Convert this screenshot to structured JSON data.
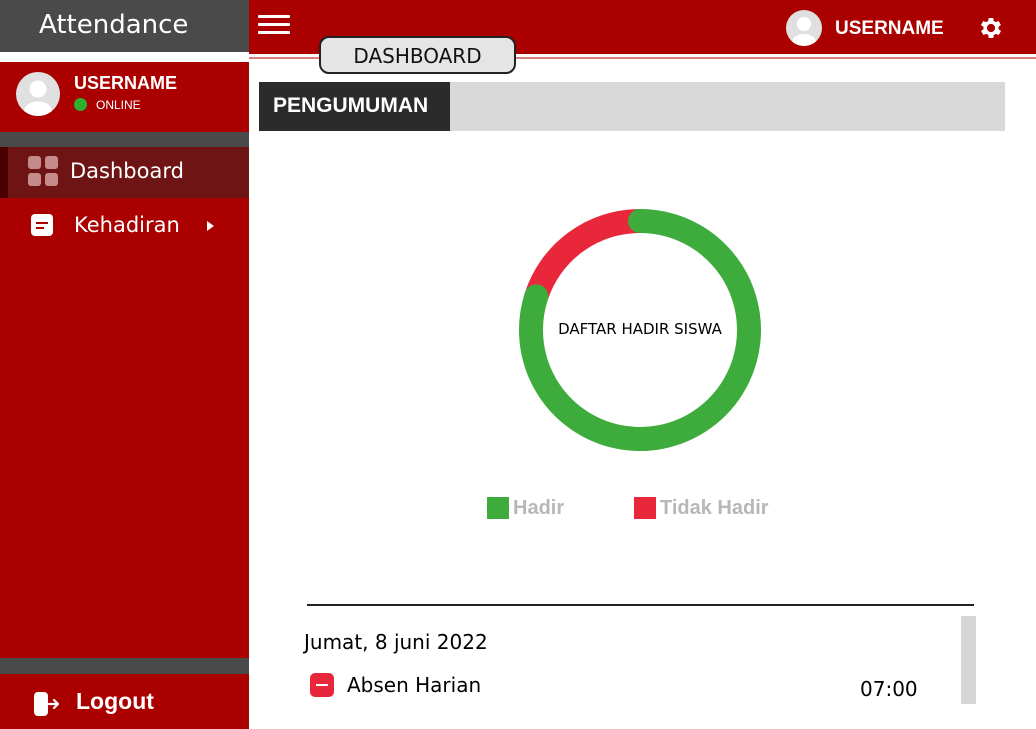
{
  "app": {
    "title": "Attendance"
  },
  "header": {
    "username": "USERNAME",
    "breadcrumb": "DASHBOARD"
  },
  "sidebar": {
    "username": "USERNAME",
    "status": "ONLINE",
    "items": [
      {
        "label": "Dashboard",
        "icon": "dashboard-grid-icon",
        "active": true
      },
      {
        "label": "Kehadiran",
        "icon": "document-icon",
        "has_submenu": true
      }
    ],
    "logout_label": "Logout"
  },
  "main": {
    "announcement_title": "PENGUMUMAN",
    "chart_center_label": "DAFTAR HADIR SISWA",
    "entry": {
      "date": "Jumat, 8 juni 2022",
      "label": "Absen Harian",
      "time": "07:00"
    }
  },
  "colors": {
    "primary": "#ab0000",
    "sidebar_dark": "#4a4a4a",
    "present": "#3dac3d",
    "absent": "#e8283a"
  },
  "chart_data": {
    "type": "pie",
    "title": "DAFTAR HADIR SISWA",
    "donut": true,
    "series": [
      {
        "name": "Hadir",
        "value": 80,
        "color": "#3dac3d"
      },
      {
        "name": "Tidak Hadir",
        "value": 20,
        "color": "#e8283a"
      }
    ],
    "legend_position": "bottom"
  }
}
